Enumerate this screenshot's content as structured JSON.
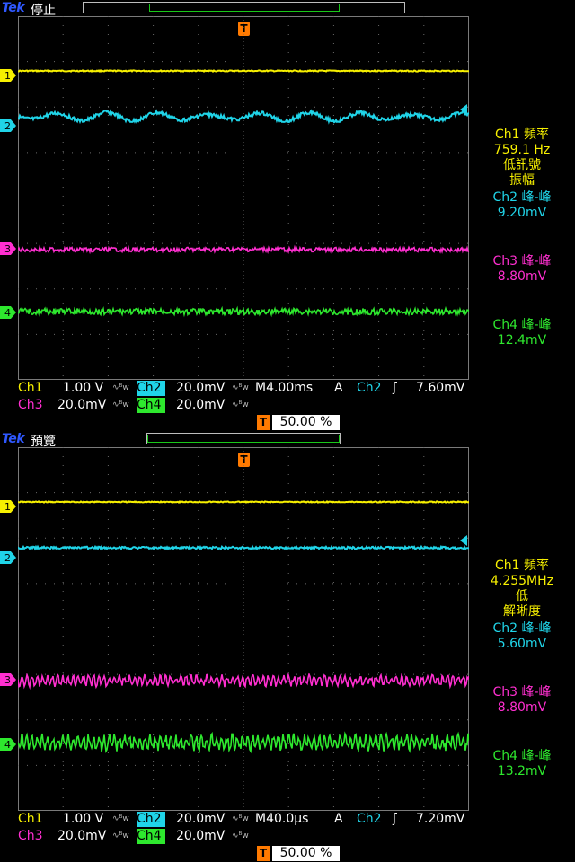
{
  "colors": {
    "ch1": "#f7f000",
    "ch2": "#20d4e8",
    "ch3": "#ff2fd0",
    "ch4": "#2ee82e",
    "trigger": "#ff7a00",
    "logo": "#2f58ff"
  },
  "screens": [
    {
      "logo": "Tek",
      "run_state": "停止",
      "trigger_icon": "T",
      "channel_markers": [
        "1",
        "2",
        "3",
        "4"
      ],
      "readouts": {
        "ch1": [
          "Ch1 頻率",
          "759.1 Hz",
          "低訊號",
          "振幅"
        ],
        "ch2": [
          "Ch2 峰-峰",
          "9.20mV"
        ],
        "ch3": [
          "Ch3 峰-峰",
          "8.80mV"
        ],
        "ch4": [
          "Ch4 峰-峰",
          "12.4mV"
        ]
      },
      "settings": {
        "ch1_label": "Ch1",
        "ch1_scale": "1.00 V",
        "ch2_label": "Ch2",
        "ch2_scale": "20.0mV",
        "ch3_label": "Ch3",
        "ch3_scale": "20.0mV",
        "ch4_label": "Ch4",
        "ch4_scale": "20.0mV",
        "timebase": "M4.00ms",
        "trigger_mode": "A",
        "trigger_source": "Ch2",
        "trigger_slope": "ʃ",
        "trigger_level": "7.60mV",
        "bw_icon": "∿ᴮw",
        "horizontal_position": "50.00 %"
      }
    },
    {
      "logo": "Tek",
      "run_state": "預覽",
      "trigger_icon": "T",
      "channel_markers": [
        "1",
        "2",
        "3",
        "4"
      ],
      "readouts": {
        "ch1": [
          "Ch1 頻率",
          "4.255MHz",
          "低",
          "解晰度"
        ],
        "ch2": [
          "Ch2 峰-峰",
          "5.60mV"
        ],
        "ch3": [
          "Ch3 峰-峰",
          "8.80mV"
        ],
        "ch4": [
          "Ch4 峰-峰",
          "13.2mV"
        ]
      },
      "settings": {
        "ch1_label": "Ch1",
        "ch1_scale": "1.00 V",
        "ch2_label": "Ch2",
        "ch2_scale": "20.0mV",
        "ch3_label": "Ch3",
        "ch3_scale": "20.0mV",
        "ch4_label": "Ch4",
        "ch4_scale": "20.0mV",
        "timebase": "M40.0µs",
        "trigger_mode": "A",
        "trigger_source": "Ch2",
        "trigger_slope": "ʃ",
        "trigger_level": "7.20mV",
        "bw_icon": "∿ᴮw",
        "horizontal_position": "50.00 %"
      }
    }
  ]
}
